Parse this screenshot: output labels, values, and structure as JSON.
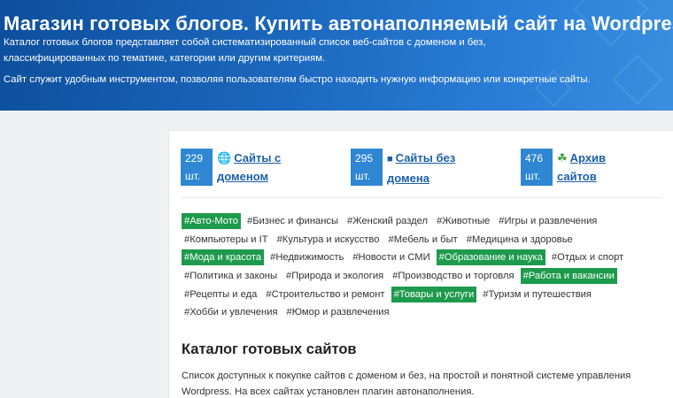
{
  "header": {
    "title": "Магазин готовых блогов. Купить автонаполняемый сайт на Wordpress",
    "desc_line1": "Каталог готовых блогов представляет собой систематизированный список веб-сайтов с доменом и без,",
    "desc_line2": "классифицированных по тематике, категории или другим критериям.",
    "desc2": "Сайт служит удобным инструментом, позволяя пользователям быстро находить нужную информацию или конкретные сайты."
  },
  "stats": [
    {
      "count": "229",
      "unit": "шт.",
      "icon": "globe-icon",
      "label_line1": "Сайты с",
      "label_line2": "доменом"
    },
    {
      "count": "295",
      "unit": "шт.",
      "icon": "folder-icon",
      "label_line1": "Сайты без",
      "label_line2": "домена"
    },
    {
      "count": "476",
      "unit": "шт.",
      "icon": "clover-icon",
      "label_line1": "Архив",
      "label_line2": "сайтов"
    }
  ],
  "tags": [
    [
      {
        "text": "#Авто-Мото",
        "active": true
      },
      {
        "text": "#Бизнес и финансы",
        "active": false
      },
      {
        "text": "#Женский раздел",
        "active": false
      },
      {
        "text": "#Животные",
        "active": false
      },
      {
        "text": "#Игры и развлечения",
        "active": false
      }
    ],
    [
      {
        "text": "#Компьютеры и IT",
        "active": false
      },
      {
        "text": "#Культура и искусство",
        "active": false
      },
      {
        "text": "#Мебель и быт",
        "active": false
      },
      {
        "text": "#Медицина и здоровье",
        "active": false
      }
    ],
    [
      {
        "text": "#Мода и красота",
        "active": true
      },
      {
        "text": "#Недвижимость",
        "active": false
      },
      {
        "text": "#Новости и СМИ",
        "active": false
      },
      {
        "text": "#Образование и наука",
        "active": true
      },
      {
        "text": "#Отдых и спорт",
        "active": false
      }
    ],
    [
      {
        "text": "#Политика и законы",
        "active": false
      },
      {
        "text": "#Природа и экология",
        "active": false
      },
      {
        "text": "#Производство и торговля",
        "active": false
      },
      {
        "text": "#Работа и вакансии",
        "active": true
      }
    ],
    [
      {
        "text": "#Рецепты и еда",
        "active": false
      },
      {
        "text": "#Строительство и ремонт",
        "active": false
      },
      {
        "text": "#Товары и услуги",
        "active": true
      },
      {
        "text": "#Туризм и путешествия",
        "active": false
      }
    ],
    [
      {
        "text": "#Хобби и увлечения",
        "active": false
      },
      {
        "text": "#Юмор и развлечения",
        "active": false
      }
    ]
  ],
  "catalog": {
    "title": "Каталог готовых сайтов",
    "text_line1": "Список доступных к покупке сайтов с доменом и без, на простой и понятной системе управления",
    "text_line2": "Wordpress. На всех сайтах установлен плагин автонаполнения."
  },
  "colors": {
    "header_bg": "#1c69c0",
    "count_badge": "#2f86d3",
    "tag_active": "#1d9a4b",
    "link": "#1b5fa8"
  }
}
